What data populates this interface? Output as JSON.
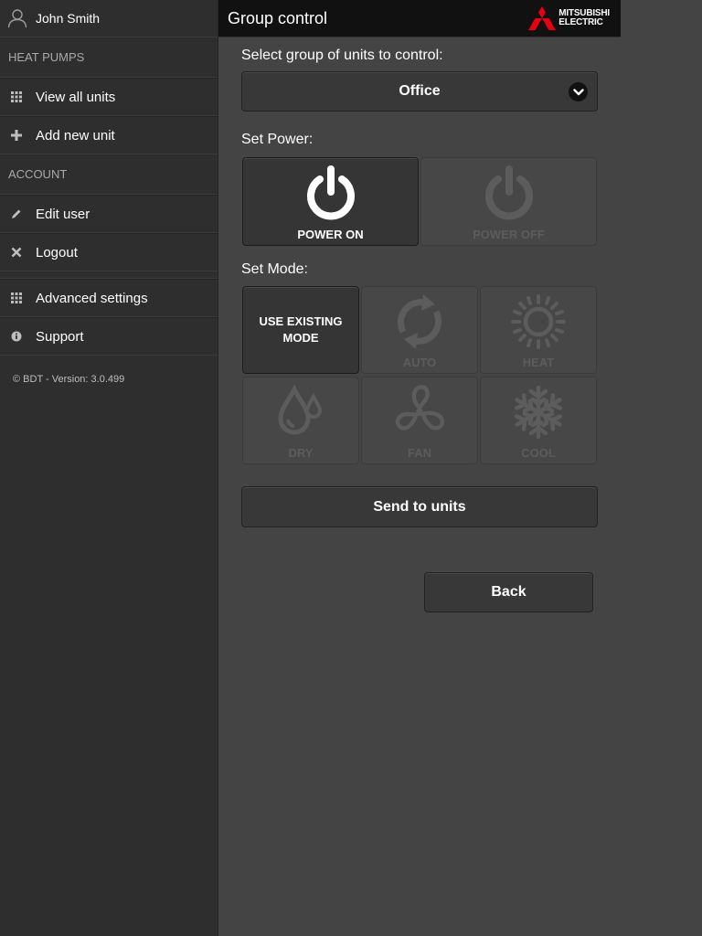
{
  "sidebar": {
    "user_name": "John Smith",
    "sections": [
      {
        "heading": "HEAT PUMPS",
        "items": [
          {
            "label": "View all units",
            "icon": "grid-icon"
          },
          {
            "label": "Add new unit",
            "icon": "plus-icon"
          }
        ]
      },
      {
        "heading": "ACCOUNT",
        "items": [
          {
            "label": "Edit user",
            "icon": "pencil-icon"
          },
          {
            "label": "Logout",
            "icon": "close-icon"
          }
        ]
      }
    ],
    "extra_items": [
      {
        "label": "Advanced settings",
        "icon": "grid-icon"
      },
      {
        "label": "Support",
        "icon": "info-icon"
      }
    ],
    "version": "© BDT - Version: 3.0.499"
  },
  "header": {
    "title": "Group control",
    "logo_line1": "MITSUBISHI",
    "logo_line2": "ELECTRIC",
    "logo_color": "#e60012"
  },
  "main": {
    "group_label": "Select group of units to control:",
    "group_selected": "Office",
    "power_label": "Set Power:",
    "power_on": "POWER ON",
    "power_off": "POWER OFF",
    "mode_label": "Set Mode:",
    "modes": {
      "existing": "USE EXISTING MODE",
      "auto": "AUTO",
      "heat": "HEAT",
      "dry": "DRY",
      "fan": "FAN",
      "cool": "COOL"
    },
    "send_label": "Send to units",
    "back_label": "Back"
  },
  "colors": {
    "background": "#444444",
    "sidebar": "#2e2e2e",
    "header": "#111111",
    "inactive_icon": "#5c5c5c"
  }
}
